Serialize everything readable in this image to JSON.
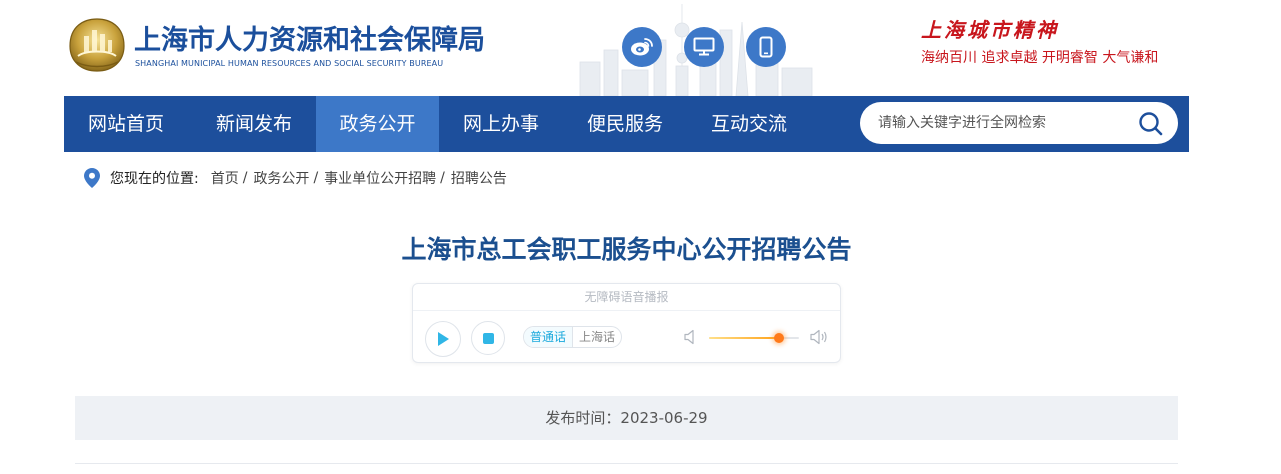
{
  "header": {
    "org_name_cn": "上海市人力资源和社会保障局",
    "org_name_en": "SHANGHAI MUNICIPAL HUMAN RESOURCES AND SOCIAL SECURITY BUREAU",
    "icons": [
      "weibo-icon",
      "desktop-icon",
      "mobile-icon"
    ],
    "spirit_title": "上海城市精神",
    "spirit_phrases": "海纳百川  追求卓越  开明睿智  大气谦和"
  },
  "nav": {
    "items": [
      {
        "label": "网站首页",
        "active": false
      },
      {
        "label": "新闻发布",
        "active": false
      },
      {
        "label": "政务公开",
        "active": true
      },
      {
        "label": "网上办事",
        "active": false
      },
      {
        "label": "便民服务",
        "active": false
      },
      {
        "label": "互动交流",
        "active": false
      }
    ],
    "search_placeholder": "请输入关键字进行全网检索"
  },
  "breadcrumb": {
    "prefix": "您现在的位置:",
    "items": [
      "首页",
      "政务公开",
      "事业单位公开招聘",
      "招聘公告"
    ],
    "separator": "/"
  },
  "article": {
    "title": "上海市总工会职工服务中心公开招聘公告",
    "publish_time": "发布时间：2023-06-29"
  },
  "audio_player": {
    "header": "无障碍语音播报",
    "dialect_selected": "普通话",
    "dialect_other": "上海话",
    "volume_fraction": 0.78
  },
  "colors": {
    "brand_blue": "#1d4f9c",
    "nav_active": "#3d78c8",
    "accent_red": "#c8161d",
    "title_blue": "#1b4f8f",
    "player_accent": "#30b6e6"
  }
}
